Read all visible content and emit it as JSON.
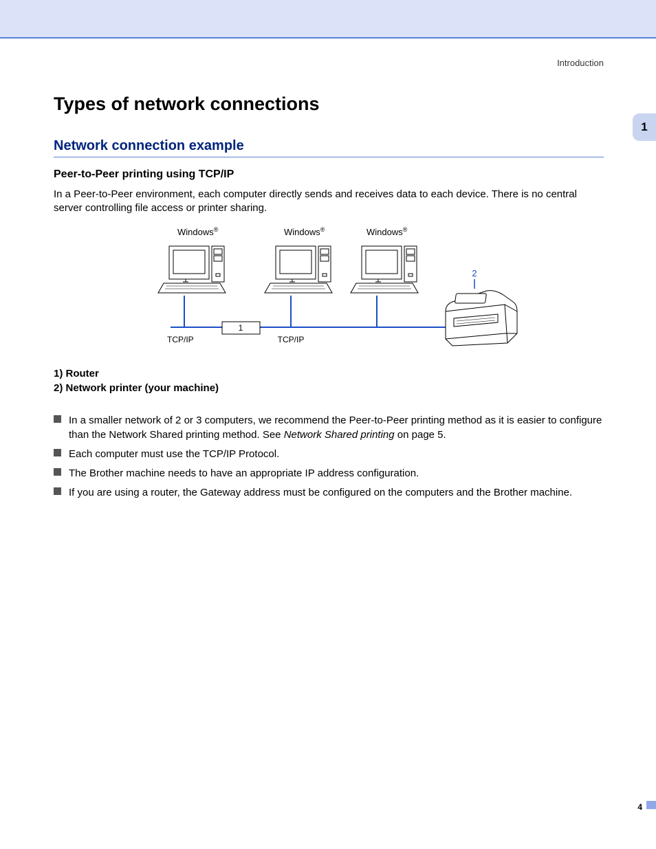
{
  "header": {
    "section": "Introduction",
    "chapter": "1"
  },
  "page": {
    "title": "Types of network connections",
    "h2": "Network connection example",
    "h3": "Peer-to-Peer printing using TCP/IP",
    "intro": "In a Peer-to-Peer environment, each computer directly sends and receives data to each device. There is no central server controlling file access or printer sharing.",
    "legend1": "1)  Router",
    "legend2": "2)  Network printer (your machine)",
    "bullets": [
      {
        "pre": "In a smaller network of 2 or 3 computers, we recommend the Peer-to-Peer printing method as it is easier to configure than the Network Shared printing method. See ",
        "link": "Network Shared printing",
        "post": " on page 5."
      },
      {
        "pre": "Each computer must use the TCP/IP Protocol.",
        "link": "",
        "post": ""
      },
      {
        "pre": "The Brother machine needs to have an appropriate IP address configuration.",
        "link": "",
        "post": ""
      },
      {
        "pre": "If you are using a router, the Gateway address must be configured on the computers and the Brother machine.",
        "link": "",
        "post": ""
      }
    ],
    "number": "4"
  },
  "diagram": {
    "os_label": "Windows",
    "reg": "®",
    "tcpip": "TCP/IP",
    "router_num": "1",
    "printer_num": "2"
  }
}
